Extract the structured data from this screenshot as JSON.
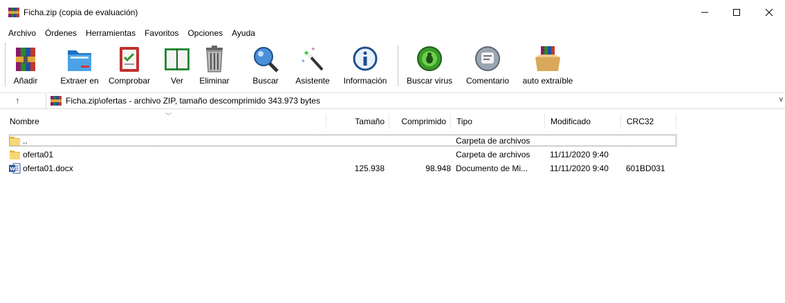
{
  "window": {
    "title": "Ficha.zip (copia de evaluación)"
  },
  "menu": [
    "Archivo",
    "Órdenes",
    "Herramientas",
    "Favoritos",
    "Opciones",
    "Ayuda"
  ],
  "toolbar": {
    "add": "Añadir",
    "extract": "Extraer en",
    "test": "Comprobar",
    "view": "Ver",
    "delete": "Eliminar",
    "find": "Buscar",
    "wizard": "Asistente",
    "info": "Información",
    "virus": "Buscar virus",
    "comment": "Comentario",
    "sfx": "auto extraíble"
  },
  "address": {
    "path": "Ficha.zip\\ofertas - archivo ZIP, tamaño descomprimido 343.973 bytes"
  },
  "columns": {
    "name": "Nombre",
    "size": "Tamaño",
    "packed": "Comprimido",
    "type": "Tipo",
    "modified": "Modificado",
    "crc": "CRC32"
  },
  "files": [
    {
      "icon": "folder-icon",
      "name": "..",
      "size": "",
      "packed": "",
      "type": "Carpeta de archivos",
      "modified": "",
      "crc": ""
    },
    {
      "icon": "folder-icon",
      "name": "oferta01",
      "size": "",
      "packed": "",
      "type": "Carpeta de archivos",
      "modified": "11/11/2020 9:40",
      "crc": ""
    },
    {
      "icon": "word-document-icon",
      "name": "oferta01.docx",
      "size": "125.938",
      "packed": "98.948",
      "type": "Documento de Mi...",
      "modified": "11/11/2020 9:40",
      "crc": "601BD031"
    }
  ],
  "colors": {
    "folder": "#f8d775",
    "word": "#2b579a",
    "accent": "#0078d7"
  }
}
